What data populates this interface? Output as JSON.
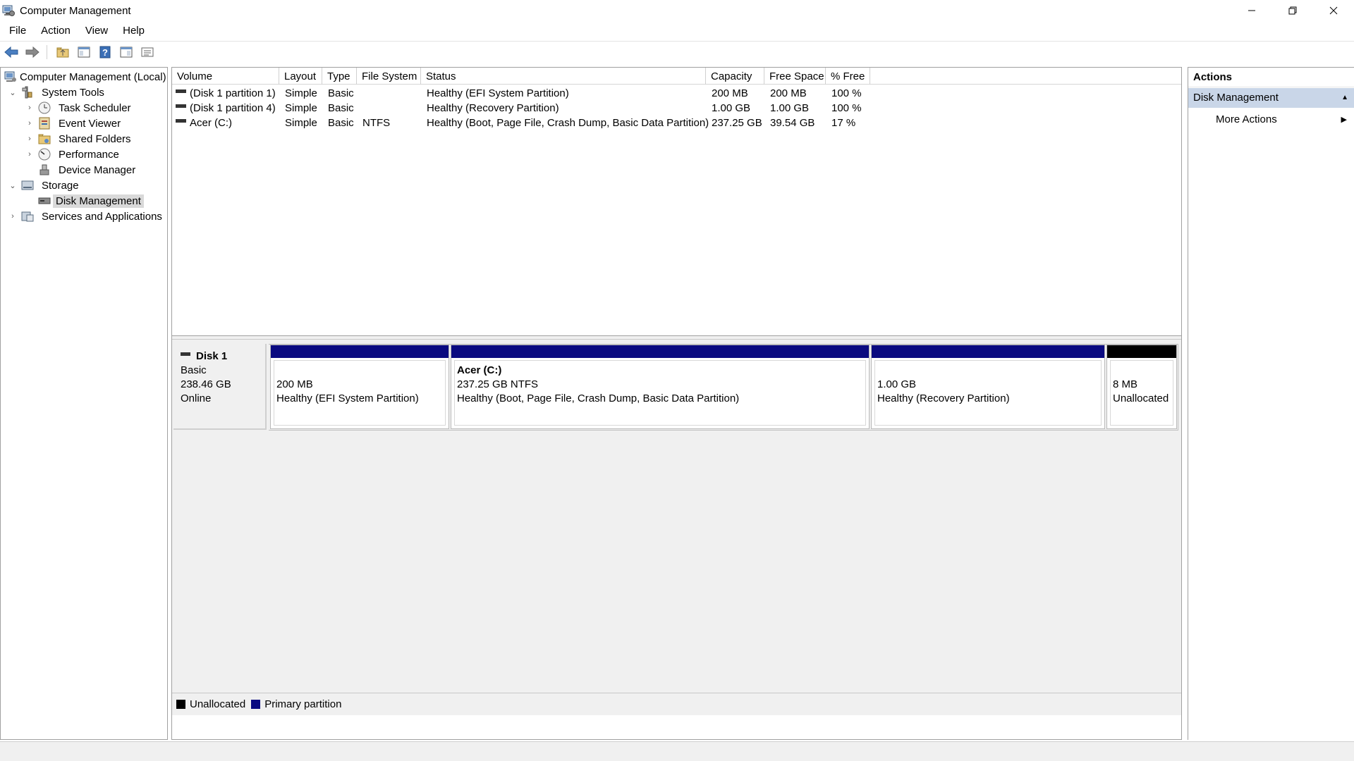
{
  "window": {
    "title": "Computer Management",
    "controls": {
      "minimize_icon": "minimize-icon",
      "restore_icon": "restore-icon",
      "close_icon": "close-icon"
    }
  },
  "menu": [
    "File",
    "Action",
    "View",
    "Help"
  ],
  "toolbar": [
    "back-arrow-icon",
    "forward-arrow-icon",
    "up-folder-icon",
    "show-hide-tree-icon",
    "help-icon",
    "show-hide-action-pane-icon",
    "properties-icon"
  ],
  "tree": {
    "root": "Computer Management (Local)",
    "system_tools": "System Tools",
    "task_scheduler": "Task Scheduler",
    "event_viewer": "Event Viewer",
    "shared_folders": "Shared Folders",
    "performance": "Performance",
    "device_manager": "Device Manager",
    "storage": "Storage",
    "disk_management": "Disk Management",
    "services_apps": "Services and Applications"
  },
  "volume_list": {
    "columns": [
      "Volume",
      "Layout",
      "Type",
      "File System",
      "Status",
      "Capacity",
      "Free Space",
      "% Free"
    ],
    "rows": [
      {
        "volume": "(Disk 1 partition 1)",
        "layout": "Simple",
        "type": "Basic",
        "fs": "",
        "status": "Healthy (EFI System Partition)",
        "capacity": "200 MB",
        "free": "200 MB",
        "pct": "100 %"
      },
      {
        "volume": "(Disk 1 partition 4)",
        "layout": "Simple",
        "type": "Basic",
        "fs": "",
        "status": "Healthy (Recovery Partition)",
        "capacity": "1.00 GB",
        "free": "1.00 GB",
        "pct": "100 %"
      },
      {
        "volume": "Acer (C:)",
        "layout": "Simple",
        "type": "Basic",
        "fs": "NTFS",
        "status": "Healthy (Boot, Page File, Crash Dump, Basic Data Partition)",
        "capacity": "237.25 GB",
        "free": "39.54 GB",
        "pct": "17 %"
      }
    ]
  },
  "disk": {
    "name": "Disk 1",
    "type": "Basic",
    "size": "238.46 GB",
    "status": "Online",
    "partitions": [
      {
        "name": "",
        "size": "200 MB",
        "status": "Healthy (EFI System Partition)",
        "kind": "primary"
      },
      {
        "name": "Acer  (C:)",
        "size": "237.25 GB NTFS",
        "status": "Healthy (Boot, Page File, Crash Dump, Basic Data Partition)",
        "kind": "primary"
      },
      {
        "name": "",
        "size": "1.00 GB",
        "status": "Healthy (Recovery Partition)",
        "kind": "primary"
      },
      {
        "name": "",
        "size": "8 MB",
        "status": "Unallocated",
        "kind": "unallocated"
      }
    ]
  },
  "legend": {
    "unallocated": "Unallocated",
    "primary": "Primary partition"
  },
  "colors": {
    "primary": "#0a0a80",
    "unallocated": "#000000",
    "actions_header": "#c9d6e8"
  },
  "actions": {
    "title": "Actions",
    "section": "Disk Management",
    "more": "More Actions"
  }
}
